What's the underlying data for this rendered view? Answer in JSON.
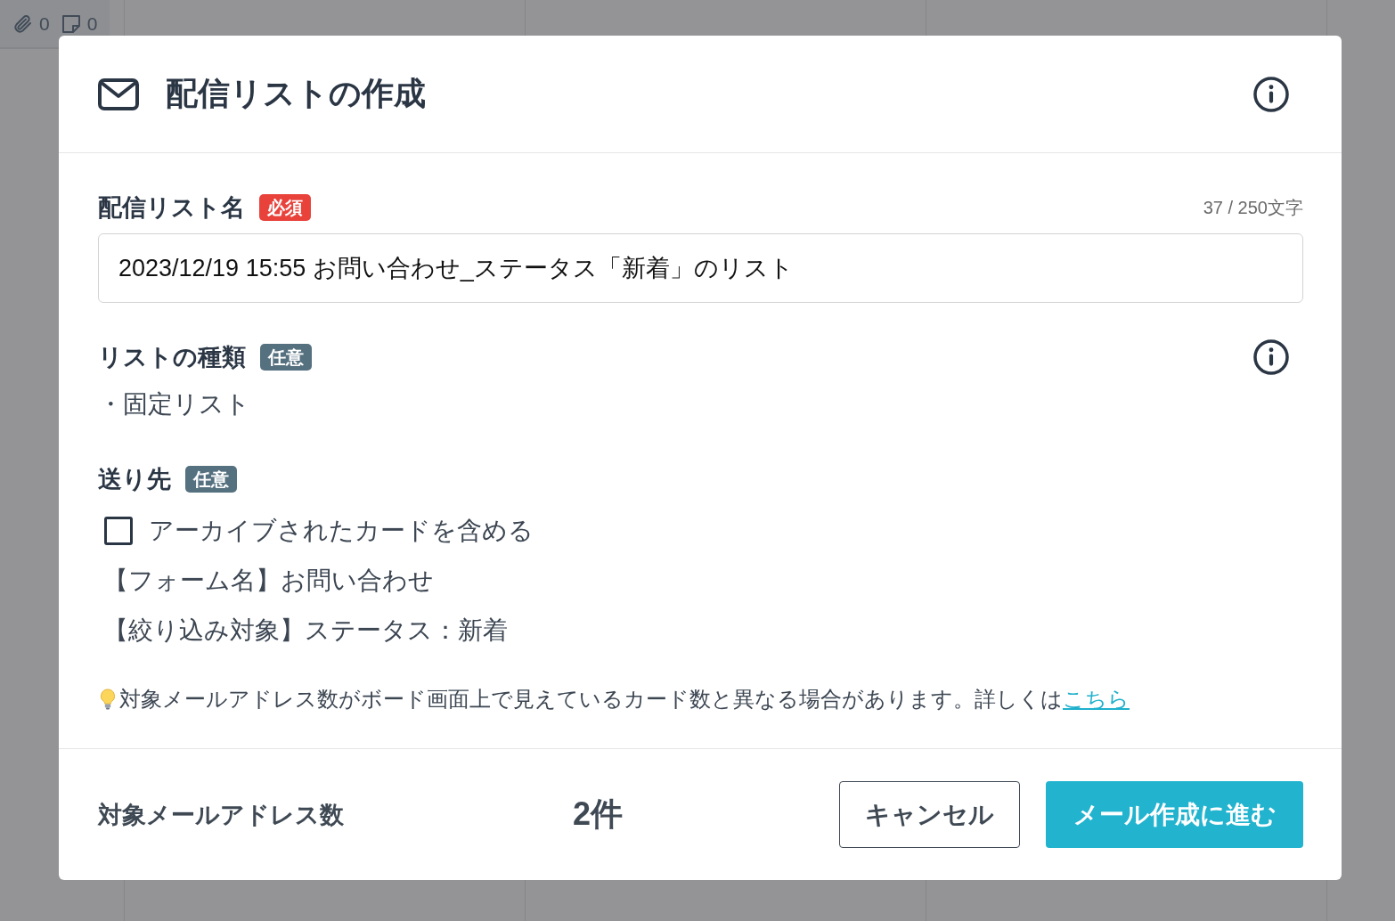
{
  "background_card": {
    "attachments": "0",
    "notes": "0"
  },
  "dialog": {
    "title": "配信リストの作成"
  },
  "name_field": {
    "label": "配信リスト名",
    "badge": {
      "text": "必須",
      "kind": "required"
    },
    "counter": "37 / 250文字",
    "value": "2023/12/19 15:55 お問い合わせ_ステータス「新着」のリスト"
  },
  "list_type": {
    "label": "リストの種類",
    "badge": {
      "text": "任意",
      "kind": "optional"
    },
    "value": "・固定リスト"
  },
  "recipients": {
    "label": "送り先",
    "badge": {
      "text": "任意",
      "kind": "optional"
    },
    "include_archived": {
      "label": "アーカイブされたカードを含める",
      "checked": false
    },
    "conditions": [
      "【フォーム名】お問い合わせ",
      "【絞り込み対象】ステータス：新着"
    ]
  },
  "notice": {
    "text": "対象メールアドレス数がボード画面上で見えているカード数と異なる場合があります。詳しくは",
    "link": "こちら"
  },
  "footer": {
    "count_label": "対象メールアドレス数",
    "count": "2件",
    "buttons": [
      {
        "label": "キャンセル",
        "kind": "secondary"
      },
      {
        "label": "メール作成に進む",
        "kind": "primary"
      }
    ]
  }
}
